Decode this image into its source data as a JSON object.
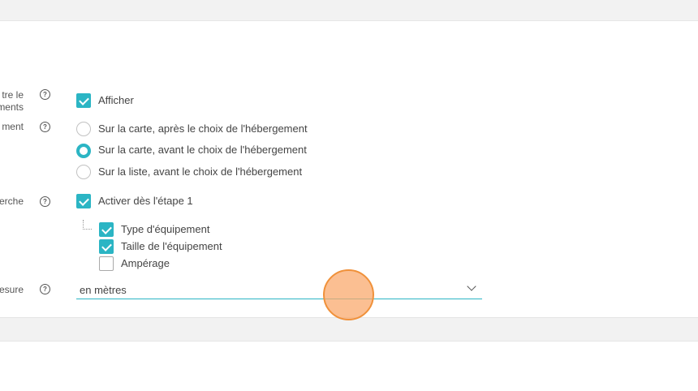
{
  "settings": {
    "row1": {
      "label_line1": "tre le",
      "label_line2": "ments",
      "checkbox_label": "Afficher",
      "checked": true
    },
    "row2": {
      "label": "ment",
      "options": [
        {
          "label": "Sur la carte, après le choix de l'hébergement",
          "selected": false
        },
        {
          "label": "Sur la carte, avant le choix de l'hébergement",
          "selected": true
        },
        {
          "label": "Sur la liste, avant le choix de l'hébergement",
          "selected": false
        }
      ]
    },
    "row3": {
      "label": "erche",
      "checkbox_label": "Activer dès l'étape 1",
      "checked": true,
      "sub_items": [
        {
          "label": "Type d'équipement",
          "checked": true
        },
        {
          "label": "Taille de l'équipement",
          "checked": true
        },
        {
          "label": "Ampérage",
          "checked": false
        }
      ]
    },
    "row4": {
      "label": "esure",
      "select_value": "en mètres"
    }
  },
  "icons": {
    "help": "help-circle-icon",
    "dropdown": "chevron-down-icon"
  },
  "colors": {
    "accent": "#2bb5c4",
    "cursor_highlight": "#f0913a"
  },
  "help_glyph": "?"
}
